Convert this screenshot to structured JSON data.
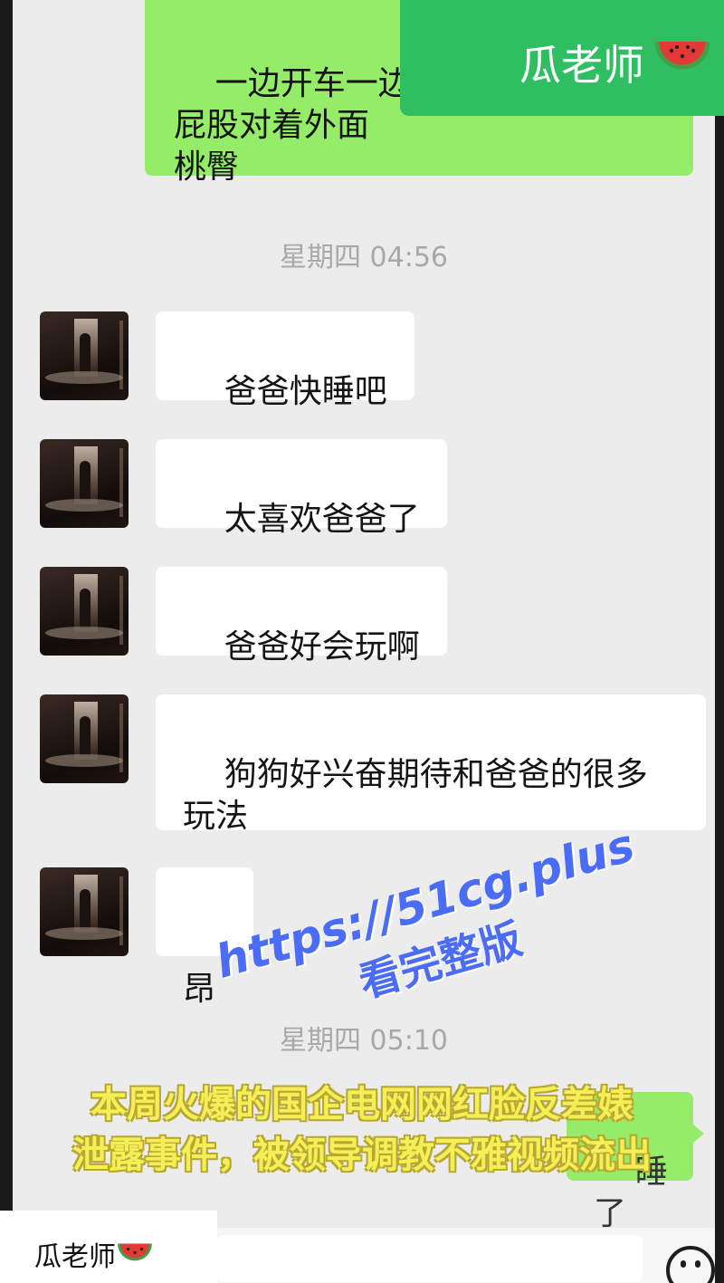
{
  "top_message": {
    "text": "一边开车一边\n屁股对着外面\n桃臀"
  },
  "watermark_badge": {
    "label": "瓜老师",
    "icon": "watermelon-icon",
    "color": "#2fbf62"
  },
  "timestamps": {
    "first": "星期四 04:56",
    "second": "星期四 05:10"
  },
  "messages": [
    {
      "text": "爸爸快睡吧"
    },
    {
      "text": "太喜欢爸爸了"
    },
    {
      "text": "爸爸好会玩啊"
    },
    {
      "text": "狗狗好兴奋期待和爸爸的很多\n玩法"
    },
    {
      "text": "昂"
    }
  ],
  "bottom_outgoing": {
    "text": "睡了"
  },
  "promo_overlay": {
    "url": "https://51cg.plus",
    "subtitle": "看完整版",
    "caption_line1": "本周火爆的国企电网网红脸反差婊",
    "caption_line2": "泄露事件，被领导调教不雅视频流出",
    "url_color": "#4a6cf7",
    "caption_color": "#f4ef56"
  },
  "bottom_label": {
    "text": "瓜老师",
    "icon": "watermelon-icon"
  },
  "emoji_button": {
    "icon": "emoji-smile-icon"
  }
}
